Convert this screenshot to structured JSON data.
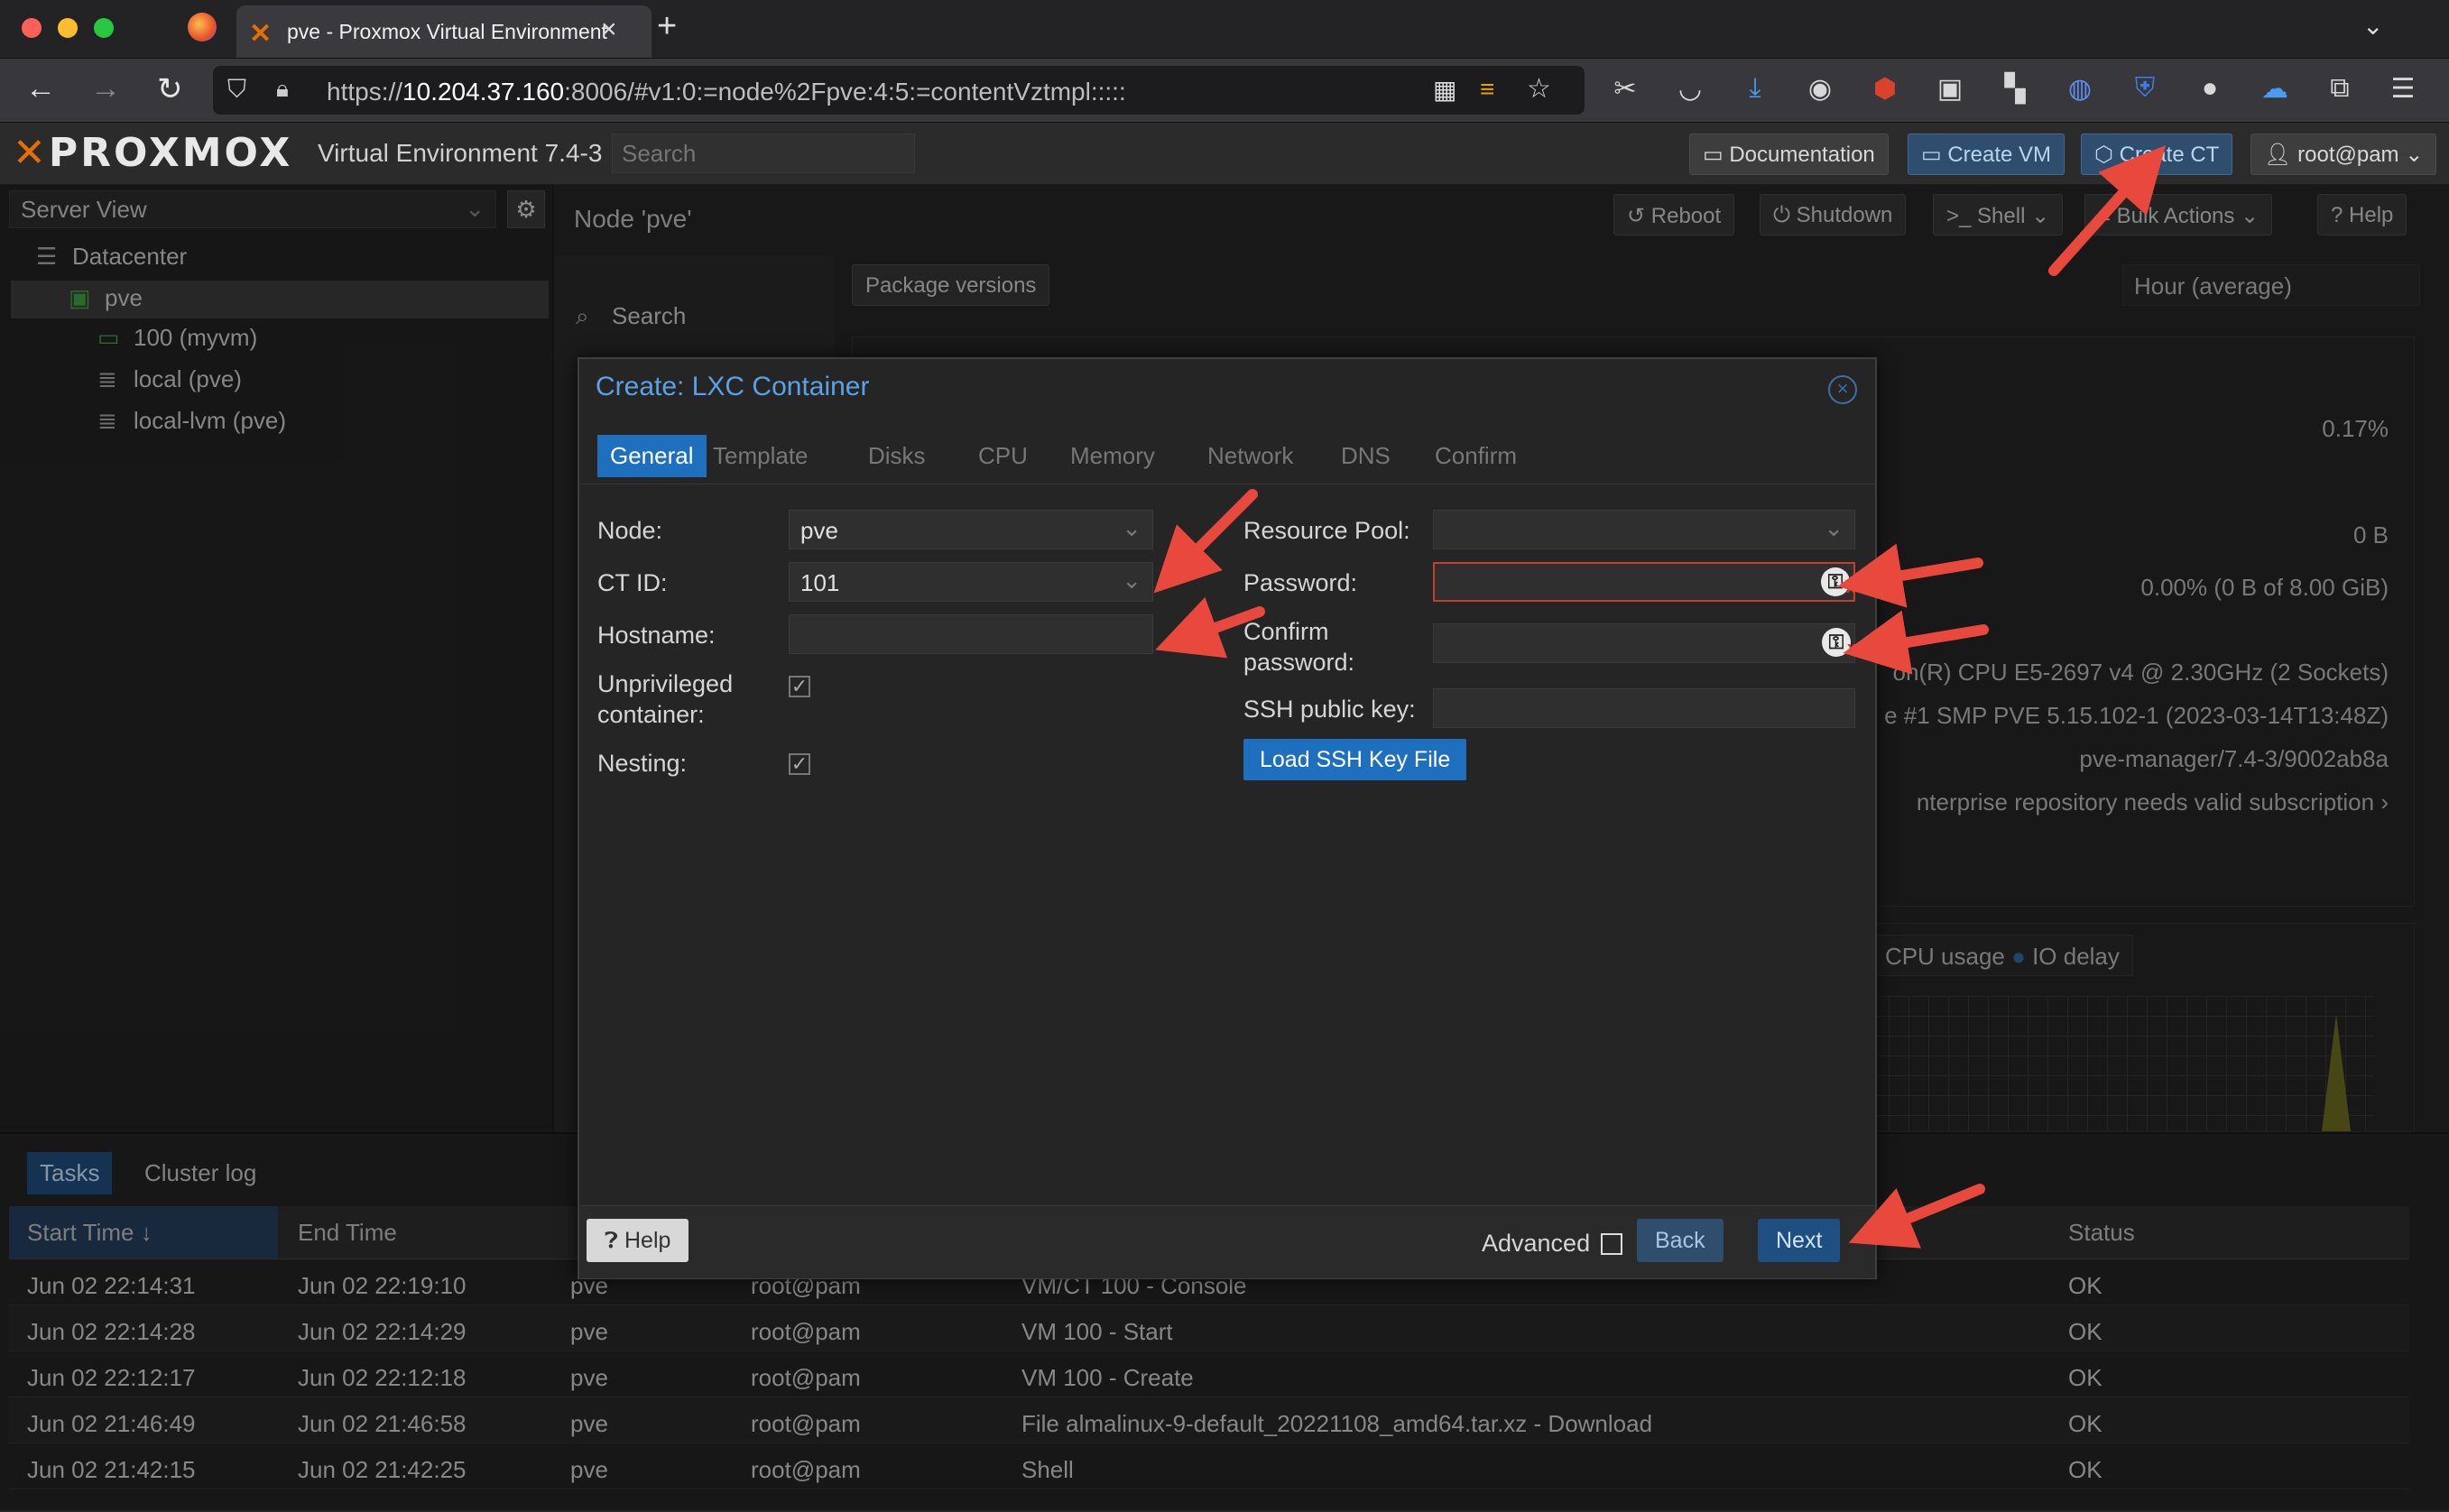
{
  "browser": {
    "tab_title": "pve - Proxmox Virtual Environment",
    "url_prefix": "https://",
    "url_host": "10.204.37.160",
    "url_rest": ":8006/#v1:0:=node%2Fpve:4:5:=contentVztmpl:::::"
  },
  "header": {
    "logo": "PROXMOX",
    "version": "Virtual Environment 7.4-3",
    "search_placeholder": "Search",
    "documentation": "Documentation",
    "create_vm": "Create VM",
    "create_ct": "Create CT",
    "user": "root@pam"
  },
  "sidebar": {
    "view": "Server View",
    "items": [
      {
        "label": "Datacenter",
        "icon": "datacenter-icon"
      },
      {
        "label": "pve",
        "icon": "node-icon"
      },
      {
        "label": "100 (myvm)",
        "icon": "vm-icon"
      },
      {
        "label": "local (pve)",
        "icon": "storage-icon"
      },
      {
        "label": "local-lvm (pve)",
        "icon": "storage-icon"
      }
    ]
  },
  "content": {
    "title": "Node 'pve'",
    "buttons": {
      "reboot": "Reboot",
      "shutdown": "Shutdown",
      "shell": "Shell",
      "bulk": "Bulk Actions",
      "help": "Help"
    },
    "nav_search": "Search",
    "package_versions": "Package versions",
    "timeframe": "Hour (average)",
    "summary_lines": [
      "0.17%",
      "0 B",
      "0.00% (0 B of 8.00 GiB)",
      "on(R) CPU E5-2697 v4 @ 2.30GHz (2 Sockets)",
      "e #1 SMP PVE 5.15.102-1 (2023-03-14T13:48Z)",
      "pve-manager/7.4-3/9002ab8a",
      "nterprise repository needs valid subscription"
    ],
    "legend": {
      "cpu": "CPU usage",
      "io": "IO delay"
    }
  },
  "dialog": {
    "title": "Create: LXC Container",
    "tabs": [
      "General",
      "Template",
      "Disks",
      "CPU",
      "Memory",
      "Network",
      "DNS",
      "Confirm"
    ],
    "node_label": "Node:",
    "node_value": "pve",
    "ctid_label": "CT ID:",
    "ctid_value": "101",
    "hostname_label": "Hostname:",
    "hostname_value": "",
    "unpriv_label_1": "Unprivileged",
    "unpriv_label_2": "container:",
    "unprivileged_checked": true,
    "nesting_label": "Nesting:",
    "nesting_checked": true,
    "pool_label": "Resource Pool:",
    "pool_value": "",
    "password_label": "Password:",
    "confirm_label_1": "Confirm",
    "confirm_label_2": "password:",
    "ssh_label": "SSH public key:",
    "ssh_button": "Load SSH Key File",
    "help": "Help",
    "advanced": "Advanced",
    "advanced_checked": false,
    "back": "Back",
    "next": "Next"
  },
  "tasks": {
    "tabs": [
      "Tasks",
      "Cluster log"
    ],
    "columns": [
      "Start Time ↓",
      "End Time",
      "Status"
    ],
    "rows": [
      {
        "start": "Jun 02 22:14:31",
        "end": "Jun 02 22:19:10",
        "node": "pve",
        "user": "root@pam",
        "desc": "VM/CT 100 - Console",
        "status": "OK"
      },
      {
        "start": "Jun 02 22:14:28",
        "end": "Jun 02 22:14:29",
        "node": "pve",
        "user": "root@pam",
        "desc": "VM 100 - Start",
        "status": "OK"
      },
      {
        "start": "Jun 02 22:12:17",
        "end": "Jun 02 22:12:18",
        "node": "pve",
        "user": "root@pam",
        "desc": "VM 100 - Create",
        "status": "OK"
      },
      {
        "start": "Jun 02 21:46:49",
        "end": "Jun 02 21:46:58",
        "node": "pve",
        "user": "root@pam",
        "desc": "File almalinux-9-default_20221108_amd64.tar.xz - Download",
        "status": "OK"
      },
      {
        "start": "Jun 02 21:42:15",
        "end": "Jun 02 21:42:25",
        "node": "pve",
        "user": "root@pam",
        "desc": "Shell",
        "status": "OK"
      }
    ]
  },
  "colors": {
    "accent": "#1f6fbf",
    "brand": "#e57000",
    "annotation": "#e8493c",
    "error_border": "#c0412f"
  }
}
